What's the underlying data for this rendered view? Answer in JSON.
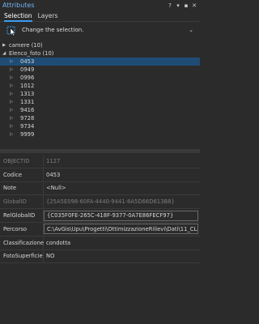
{
  "window": {
    "title": "Attributes",
    "buttons": [
      "?",
      "▾",
      "▪",
      "✕"
    ]
  },
  "tabs": [
    {
      "label": "Selection",
      "active": true
    },
    {
      "label": "Layers",
      "active": false
    }
  ],
  "toolbar": {
    "instruction": "Change the selection."
  },
  "tree": [
    {
      "label": "camere (10)",
      "expanded": false
    },
    {
      "label": "Elenco_foto (10)",
      "expanded": true,
      "children": [
        "0453",
        "0949",
        "0996",
        "1012",
        "1313",
        "1331",
        "9416",
        "9728",
        "9734",
        "9999"
      ],
      "selected_index": 0
    }
  ],
  "attributes": [
    {
      "field": "OBJECTID",
      "value": "1127",
      "readonly": true
    },
    {
      "field": "Codice",
      "value": "0453",
      "readonly": false
    },
    {
      "field": "Note",
      "value": "<Null>",
      "readonly": false
    },
    {
      "field": "GlobalID",
      "value": "{25A5E098-60FA-4440-9441-8A5D66D613B8}",
      "readonly": true
    },
    {
      "field": "RelGlobalID",
      "value": "{C035F0FE-265C-418F-9377-0A7E86FECF97}",
      "readonly": false,
      "boxed": true
    },
    {
      "field": "Percorso",
      "value": "C:\\AvGis\\Upu\\Progetti\\OttimizzazioneRilievi\\Dati\\11_CLAUT\\11_",
      "readonly": false,
      "boxed": true
    },
    {
      "field": "Classificazione",
      "value": "condotta",
      "readonly": false
    },
    {
      "field": "FotoSuperficie",
      "value": "NO",
      "readonly": false
    }
  ],
  "colors": {
    "background": "#2b2b2b",
    "accent": "#3a9bf0",
    "selection": "#1f4c75"
  }
}
